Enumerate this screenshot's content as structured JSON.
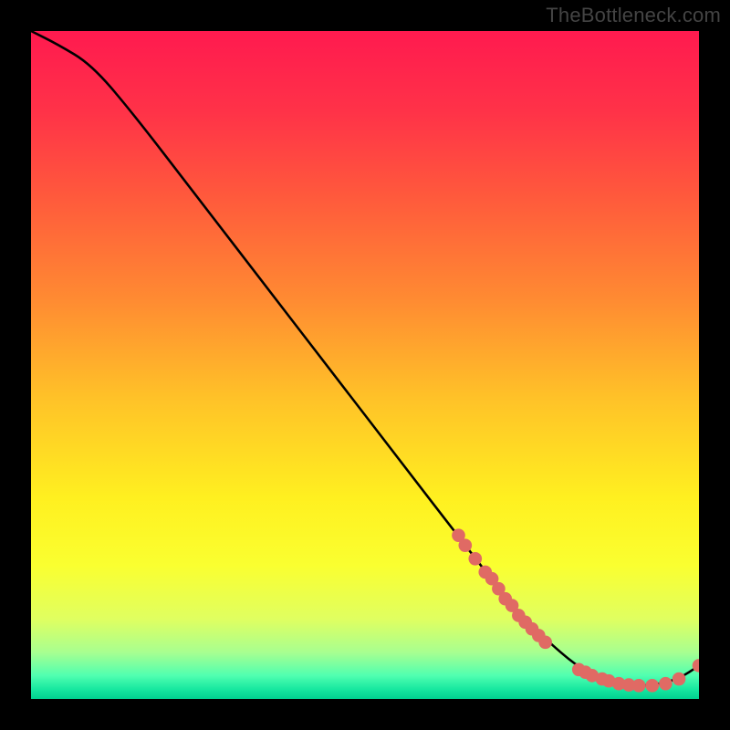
{
  "watermark": "TheBottleneck.com",
  "chart_data": {
    "type": "line",
    "title": "",
    "xlabel": "",
    "ylabel": "",
    "xlim": [
      0,
      100
    ],
    "ylim": [
      0,
      100
    ],
    "grid": false,
    "curve": [
      {
        "x": 0,
        "y": 100
      },
      {
        "x": 4,
        "y": 98
      },
      {
        "x": 9,
        "y": 95
      },
      {
        "x": 15,
        "y": 88
      },
      {
        "x": 25,
        "y": 75
      },
      {
        "x": 35,
        "y": 62
      },
      {
        "x": 45,
        "y": 49
      },
      {
        "x": 55,
        "y": 36
      },
      {
        "x": 65,
        "y": 23
      },
      {
        "x": 72,
        "y": 14
      },
      {
        "x": 78,
        "y": 8
      },
      {
        "x": 83,
        "y": 4
      },
      {
        "x": 88,
        "y": 2
      },
      {
        "x": 93,
        "y": 2
      },
      {
        "x": 97,
        "y": 3
      },
      {
        "x": 100,
        "y": 5
      }
    ],
    "markers_upper_segment": [
      {
        "x": 64,
        "y": 24.5
      },
      {
        "x": 65,
        "y": 23
      },
      {
        "x": 66.5,
        "y": 21
      },
      {
        "x": 68,
        "y": 19
      },
      {
        "x": 69,
        "y": 18
      },
      {
        "x": 70,
        "y": 16.5
      },
      {
        "x": 71,
        "y": 15
      },
      {
        "x": 72,
        "y": 14
      },
      {
        "x": 73,
        "y": 12.5
      },
      {
        "x": 74,
        "y": 11.5
      },
      {
        "x": 75,
        "y": 10.5
      },
      {
        "x": 76,
        "y": 9.5
      },
      {
        "x": 77,
        "y": 8.5
      }
    ],
    "markers_lower_segment": [
      {
        "x": 82,
        "y": 4.4
      },
      {
        "x": 83,
        "y": 4
      },
      {
        "x": 84,
        "y": 3.5
      },
      {
        "x": 85.5,
        "y": 3
      },
      {
        "x": 86.5,
        "y": 2.7
      },
      {
        "x": 88,
        "y": 2.3
      },
      {
        "x": 89.5,
        "y": 2.1
      },
      {
        "x": 91,
        "y": 2
      },
      {
        "x": 93,
        "y": 2
      },
      {
        "x": 95,
        "y": 2.3
      },
      {
        "x": 97,
        "y": 3
      },
      {
        "x": 100,
        "y": 5
      }
    ],
    "gradient_stops": [
      {
        "offset": 0.0,
        "color": "#ff1a4f"
      },
      {
        "offset": 0.12,
        "color": "#ff3248"
      },
      {
        "offset": 0.25,
        "color": "#ff5a3c"
      },
      {
        "offset": 0.4,
        "color": "#ff8a32"
      },
      {
        "offset": 0.55,
        "color": "#ffc228"
      },
      {
        "offset": 0.7,
        "color": "#fff020"
      },
      {
        "offset": 0.8,
        "color": "#faff30"
      },
      {
        "offset": 0.88,
        "color": "#e0ff60"
      },
      {
        "offset": 0.93,
        "color": "#a8ff90"
      },
      {
        "offset": 0.965,
        "color": "#50ffb0"
      },
      {
        "offset": 0.985,
        "color": "#18e8a0"
      },
      {
        "offset": 1.0,
        "color": "#00d090"
      }
    ],
    "marker_color": "#e06a64",
    "curve_color": "#000000"
  }
}
